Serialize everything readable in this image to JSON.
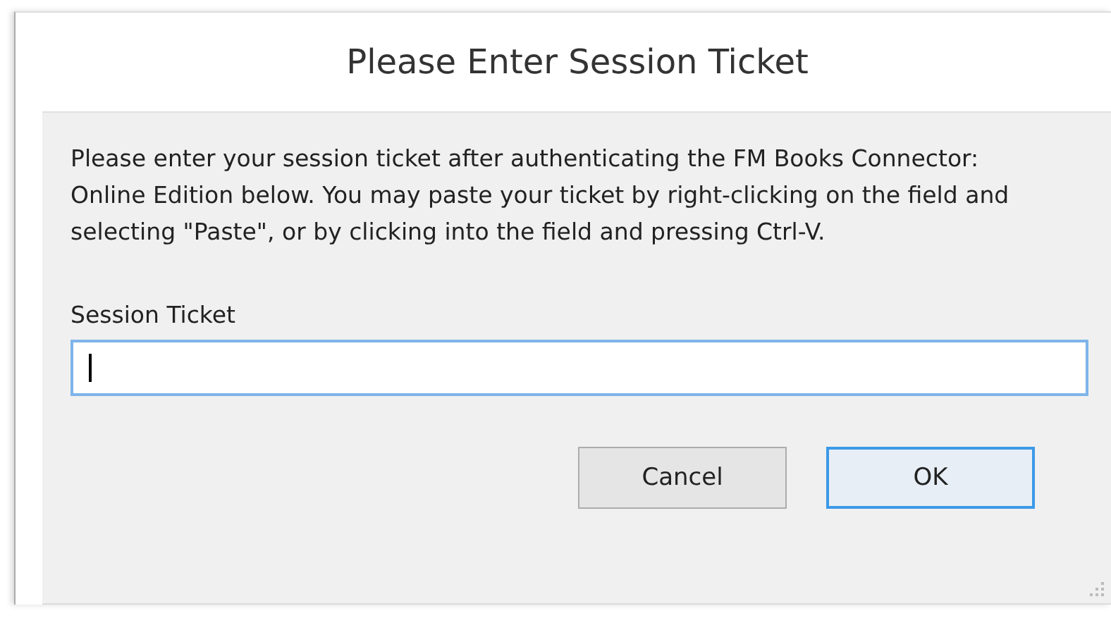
{
  "dialog": {
    "title": "Please Enter Session Ticket"
  },
  "instructions": "Please enter your session ticket after authenticating the FM Books Connector: Online Edition below.  You may paste your ticket by right-clicking on the field and selecting \"Paste\", or by clicking into the field and pressing Ctrl-V.",
  "field": {
    "label": "Session Ticket",
    "focused": true
  },
  "buttons": [
    {
      "label": "Cancel",
      "default": false
    },
    {
      "label": "OK",
      "default": true
    }
  ]
}
